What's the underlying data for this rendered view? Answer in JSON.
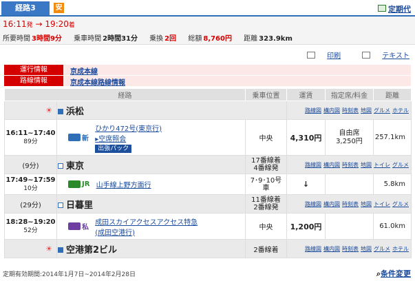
{
  "header": {
    "tab_label": "経路3",
    "yasu_badge": "安",
    "teiki_link": "定期代"
  },
  "summary": {
    "dep_time": "16:11",
    "dep_suffix": "発",
    "arrow": "→",
    "arr_time": "19:20",
    "arr_suffix": "着",
    "required_label": "所要時間",
    "required_value": "3時間9分",
    "ride_label": "乗車時間",
    "ride_value": "2時間31分",
    "transfer_label": "乗換",
    "transfer_value": "2回",
    "total_label": "総額",
    "total_value": "8,760円",
    "distance_label": "距離",
    "distance_value": "323.9km"
  },
  "tools": {
    "print": "印刷",
    "text": "テキスト"
  },
  "info": [
    {
      "label": "運行情報",
      "value": "京成本線"
    },
    {
      "label": "路線情報",
      "value": "京成本線路線情報"
    }
  ],
  "columns": {
    "route": "経路",
    "position": "乗車位置",
    "fare": "運賃",
    "seat": "指定席/料金",
    "distance": "距離"
  },
  "stations": [
    {
      "name": "浜松",
      "wait": "",
      "platform": "",
      "links": [
        "路線図",
        "構内図",
        "時刻表",
        "地図",
        "グルメ",
        "ホテル"
      ]
    },
    {
      "name": "東京",
      "wait": "(9分)",
      "platform_1": "17番線着",
      "platform_2": "4番線発",
      "links": [
        "路線図",
        "構内図",
        "時刻表",
        "地図",
        "トイレ",
        "グルメ"
      ]
    },
    {
      "name": "日暮里",
      "wait": "(29分)",
      "platform_1": "11番線着",
      "platform_2": "2番線発",
      "links": [
        "路線図",
        "構内図",
        "時刻表",
        "地図",
        "トイレ",
        "グルメ"
      ]
    },
    {
      "name": "空港第2ビル",
      "wait": "",
      "platform_1": "2番線着",
      "links": [
        "路線図",
        "構内図",
        "時刻表",
        "地図",
        "グルメ",
        "ホテル"
      ]
    }
  ],
  "segments": [
    {
      "time": "16:11~17:40",
      "duration": "89分",
      "type": "新",
      "line_1": "ひかり472号(東京行)",
      "line_2": "▸空席照会",
      "badge": "出張パック",
      "position": "中央",
      "fare": "4,310円",
      "seat_1": "自由席",
      "seat_2": "3,250円",
      "distance": "257.1km",
      "color": "#2f6fb8"
    },
    {
      "time": "17:49~17:59",
      "duration": "10分",
      "type": "JR",
      "line_1": "山手線上野方面行",
      "position_1": "7･9･10号",
      "position_2": "車",
      "fare": "↓",
      "distance": "5.8km",
      "color": "#2a8a2a"
    },
    {
      "time": "18:28~19:20",
      "duration": "52分",
      "type": "私",
      "line_1": "成田スカイアクセスアクセス特急",
      "line_2": "(成田空港行)",
      "position": "中央",
      "fare": "1,200円",
      "distance": "61.0km",
      "color": "#6d3fa3"
    }
  ],
  "footer": {
    "validity": "定期有効期間:2014年1月7日~2014年2月28日",
    "change_link": "条件変更"
  }
}
